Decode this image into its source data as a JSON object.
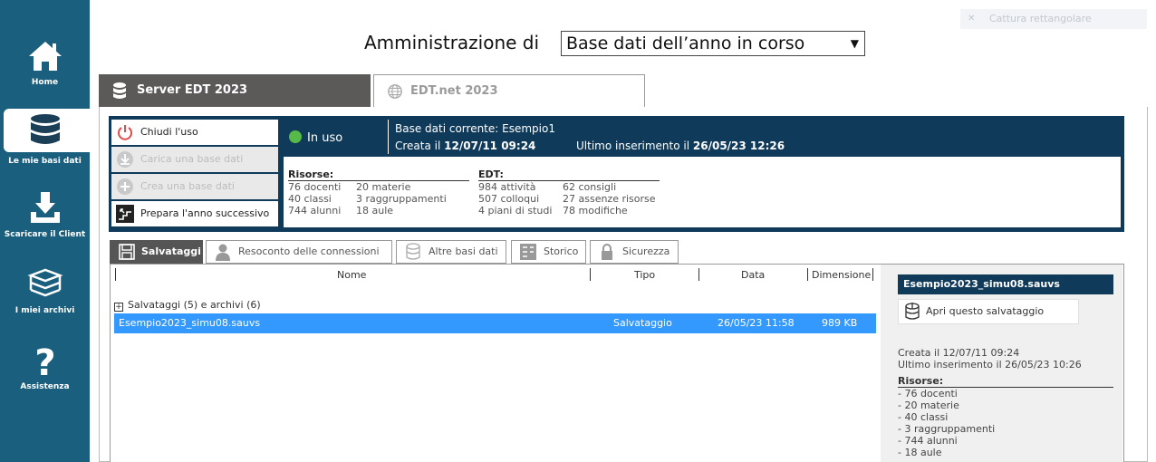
{
  "sidebar": {
    "items": [
      {
        "label": "Home",
        "icon": "home-icon"
      },
      {
        "label": "Le mie basi dati",
        "icon": "database-icon"
      },
      {
        "label": "Scaricare il Client",
        "icon": "download-icon"
      },
      {
        "label": "I miei archivi",
        "icon": "books-icon"
      },
      {
        "label": "Assistenza",
        "icon": "question-icon"
      }
    ]
  },
  "overlay": {
    "capture": "Cattura rettangolare"
  },
  "header": {
    "title": "Amministrazione di",
    "select_value": "Base dati dell’anno in corso"
  },
  "tabs": {
    "server": "Server EDT 2023",
    "net": "EDT.net 2023"
  },
  "actions": {
    "close": "Chiudi l'uso",
    "load": "Carica una base dati",
    "create": "Crea una base dati",
    "prepare": "Prepara l'anno successivo"
  },
  "status": {
    "state": "In uso",
    "state_color": "#57b947"
  },
  "db": {
    "current": "Base dati corrente: Esempio1",
    "created_label": "Creata il",
    "created_value": "12/07/11 09:24",
    "last_label": "Ultimo inserimento il",
    "last_value": "26/05/23 12:26"
  },
  "stats": {
    "resources_title": "Risorse:",
    "resources": [
      "76 docenti",
      "40 classi",
      "744 alunni",
      "20 materie",
      "3 raggruppamenti",
      "18 aule"
    ],
    "edt_title": "EDT:",
    "edt": [
      "984 attività",
      "507 colloqui",
      "4 piani di studi",
      "62 consigli",
      "27 assenze risorse",
      "78 modifiche"
    ]
  },
  "subtabs": [
    "Salvataggi",
    "Resoconto delle connessioni",
    "Altre basi dati",
    "Storico",
    "Sicurezza"
  ],
  "table": {
    "columns": [
      "Nome",
      "Tipo",
      "Data",
      "Dimensione"
    ],
    "group": "Salvataggi (5) e archivi (6)",
    "rows": [
      {
        "name": "Esempio2023_simu08.sauvs",
        "type": "Salvataggio",
        "date": "26/05/23 11:58",
        "size": "989 KB"
      }
    ]
  },
  "details": {
    "title": "Esempio2023_simu08.sauvs",
    "open": "Apri questo salvataggio",
    "created": "Creata il 12/07/11 09:24",
    "last": "Ultimo inserimento il 26/05/23 10:26",
    "resources_title": "Risorse:",
    "resources": [
      "- 76 docenti",
      "- 20 materie",
      "- 40 classi",
      "- 3 raggruppamenti",
      "- 744 alunni",
      "- 18 aule"
    ]
  },
  "colors": {
    "sidebar": "#1a5f7e",
    "navy": "#0f3a5a",
    "selection": "#3399ff",
    "tab_dark": "#5c5a59"
  }
}
